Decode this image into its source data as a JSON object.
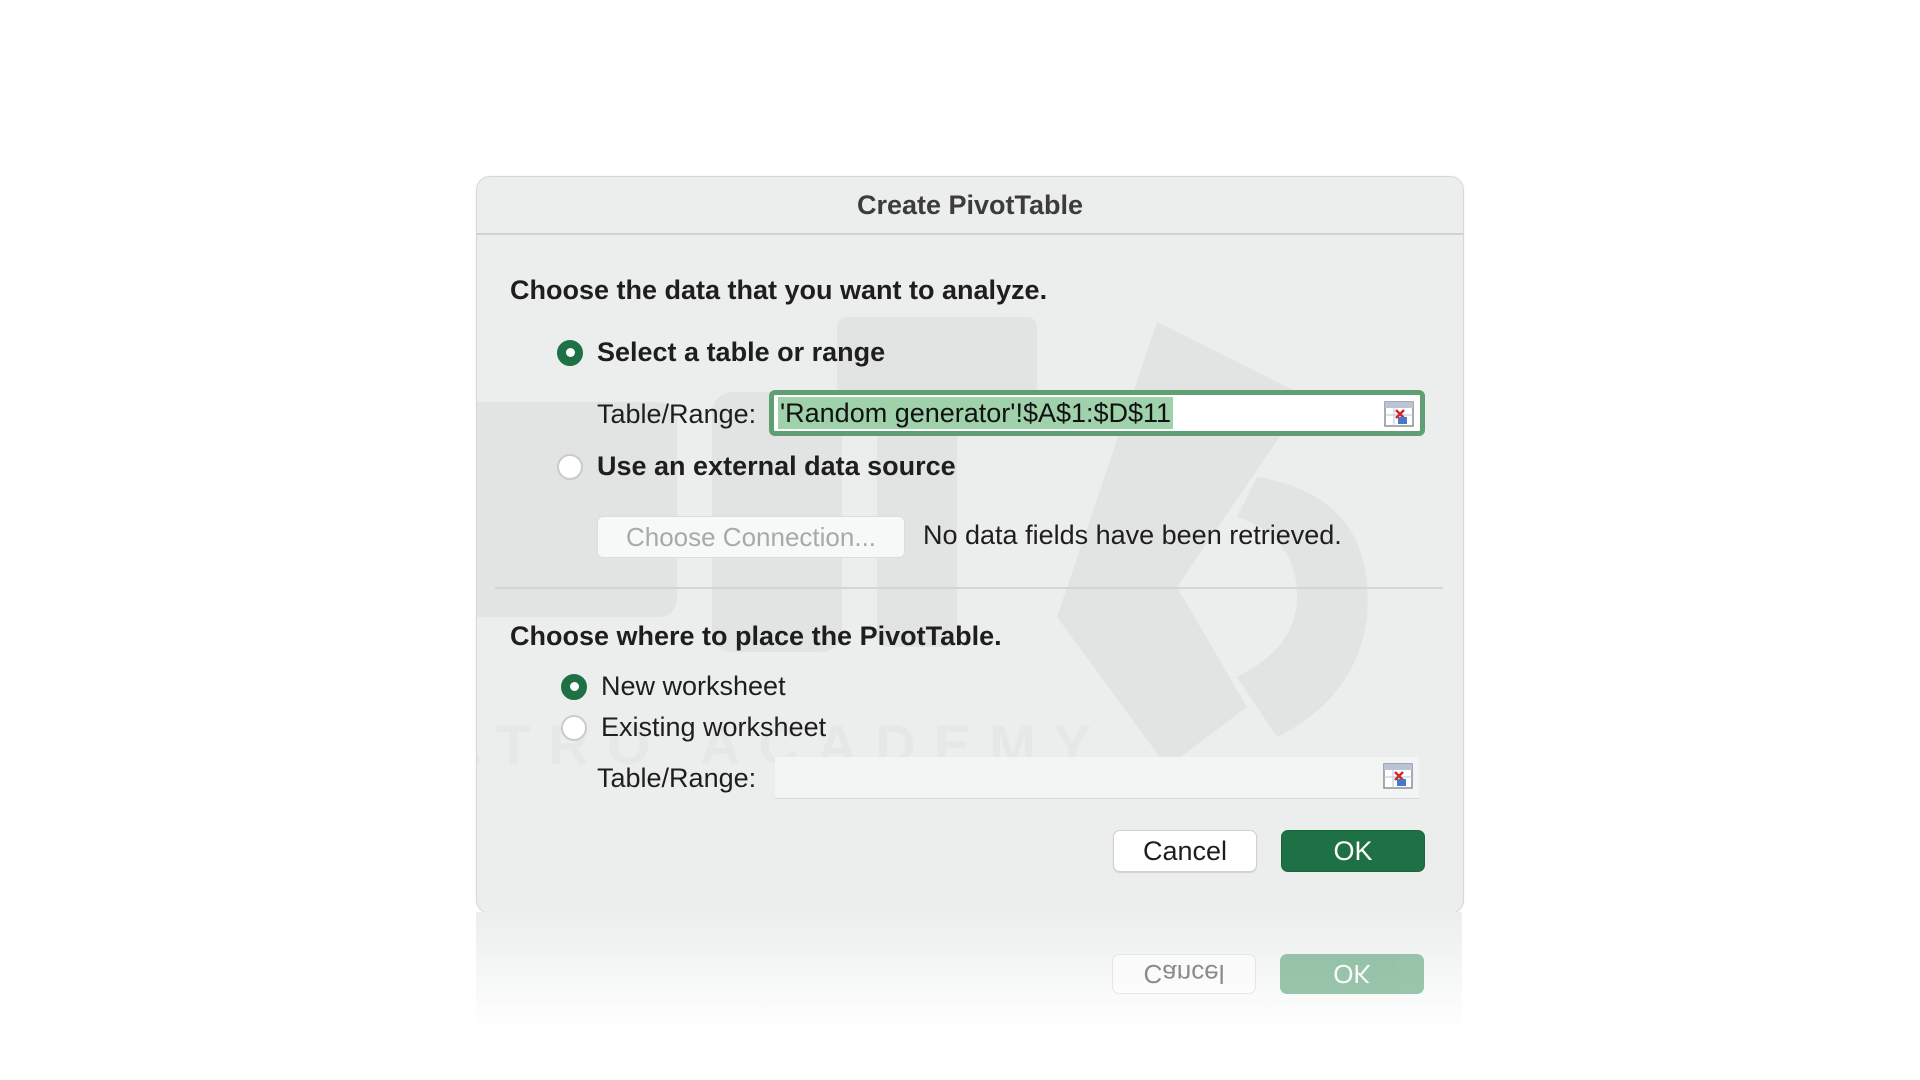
{
  "dialog": {
    "title": "Create PivotTable",
    "source_section": {
      "heading": "Choose the data that you want to analyze.",
      "option_table": {
        "label": "Select a table or range",
        "selected": true
      },
      "table_range_label": "Table/Range:",
      "table_range_value": "'Random generator'!$A$1:$D$11",
      "option_external": {
        "label": "Use an external data source",
        "selected": false
      },
      "choose_connection_label": "Choose Connection...",
      "status_text": "No data fields have been retrieved."
    },
    "placement_section": {
      "heading": "Choose where to place the PivotTable.",
      "option_new": {
        "label": "New worksheet",
        "selected": true
      },
      "option_existing": {
        "label": "Existing worksheet",
        "selected": false
      },
      "table_range_label": "Table/Range:",
      "table_range_value": ""
    },
    "buttons": {
      "cancel": "Cancel",
      "ok": "OK"
    }
  },
  "watermark": {
    "text": "ATRO ACADEMY"
  },
  "colors": {
    "accent": "#1e7145",
    "dialog_bg": "#eceeee",
    "selection": "#9fd1aa",
    "focus_ring": "#5f9f73"
  },
  "icons": {
    "range_picker": "range-picker-icon"
  }
}
